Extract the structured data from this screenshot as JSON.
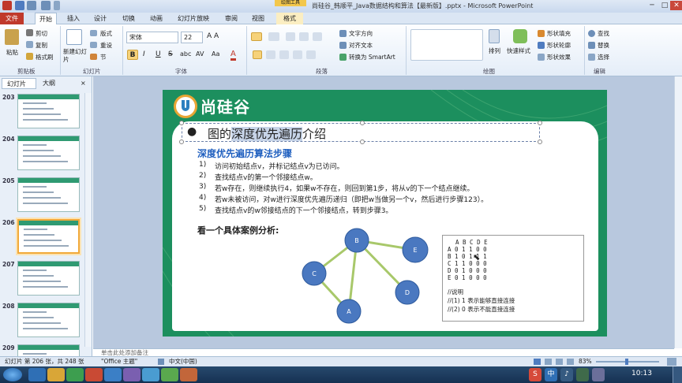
{
  "window": {
    "title": "尚硅谷_韩顺平_Java数据结构和算法【最新版】.pptx - Microsoft PowerPoint",
    "context_tab_group": "绘图工具",
    "controls": [
      "─",
      "□",
      "✕"
    ]
  },
  "tabs": [
    "文件",
    "开始",
    "插入",
    "设计",
    "切换",
    "动画",
    "幻灯片放映",
    "审阅",
    "视图",
    "格式"
  ],
  "ribbon": {
    "clipboard": {
      "paste": "粘贴",
      "cut": "剪切",
      "copy": "复制",
      "format_painter": "格式刷",
      "label": "剪贴板"
    },
    "slides": {
      "new_slide": "新建幻灯片",
      "layout": "版式",
      "reset": "重设",
      "section": "节",
      "label": "幻灯片"
    },
    "font": {
      "name": "宋体",
      "size": "22",
      "label": "字体",
      "buttons": [
        "B",
        "I",
        "U",
        "S",
        "abc",
        "AV",
        "Aa",
        "A"
      ]
    },
    "paragraph": {
      "text_direction": "文字方向",
      "align_text": "对齐文本",
      "smartart": "转换为 SmartArt",
      "label": "段落"
    },
    "drawing": {
      "arrange": "排列",
      "quick_styles": "快速样式",
      "shape_fill": "形状填充",
      "shape_outline": "形状轮廓",
      "shape_effects": "形状效果",
      "label": "绘图"
    },
    "editing": {
      "find": "查找",
      "replace": "替换",
      "select": "选择",
      "label": "编辑"
    }
  },
  "panel": {
    "tab_slides": "幻灯片",
    "tab_outline": "大纲",
    "close": "×",
    "thumbnails": [
      {
        "num": "203",
        "selected": false
      },
      {
        "num": "204",
        "selected": false
      },
      {
        "num": "205",
        "selected": false
      },
      {
        "num": "206",
        "selected": true
      },
      {
        "num": "207",
        "selected": false
      },
      {
        "num": "208",
        "selected": false
      },
      {
        "num": "209",
        "selected": false
      }
    ]
  },
  "slide": {
    "logo_text": "尚硅谷",
    "heading_pre": "图的",
    "heading_highlight": "深度优先遍历",
    "heading_post": "介绍",
    "subheading": "深度优先遍历算法步骤",
    "steps": [
      {
        "n": "1)",
        "text": "访问初始结点v，并标记结点v为已访问。"
      },
      {
        "n": "2)",
        "text": "查找结点v的第一个邻接结点w。"
      },
      {
        "n": "3)",
        "text": "若w存在，则继续执行4，如果w不存在，则回到第1步，将从v的下一个结点继续。"
      },
      {
        "n": "4)",
        "text": "若w未被访问，对w进行深度优先遍历递归（即把w当做另一个v，然后进行步骤123）。"
      },
      {
        "n": "5)",
        "text": "查找结点v的w邻接结点的下一个邻接结点，转到步骤3。"
      }
    ],
    "case_title": "看一个具体案例分析:",
    "graph_nodes": [
      "B",
      "E",
      "C",
      "D",
      "A"
    ],
    "matrix": {
      "header": "A B C D E",
      "rows": [
        "A 0 1 1 0 0",
        "B 1 0 1 1 1",
        "C 1 1 0 0 0",
        "D 0 1 0 0 0",
        "E 0 1 0 0 0"
      ],
      "note_title": "//说明",
      "note_1": "//(1) 1 表示能够直接连接",
      "note_2": "//(2) 0 表示不能直接连接"
    }
  },
  "notes_placeholder": "单击此处添加备注",
  "statusbar": {
    "slide_info": "幻灯片 第 206 张，共 248 张",
    "theme": "\"Office 主题\"",
    "language": "中文(中国)",
    "zoom": "83%"
  },
  "taskbar": {
    "time": "10:13",
    "tray": [
      "S",
      "中",
      "♪"
    ]
  },
  "colors": {
    "slide_green": "#1c8f5e",
    "node_blue": "#4a78c0",
    "edge_green": "#a8c86a",
    "subheading_blue": "#1f5fbf",
    "file_tab_red": "#c0392b"
  }
}
